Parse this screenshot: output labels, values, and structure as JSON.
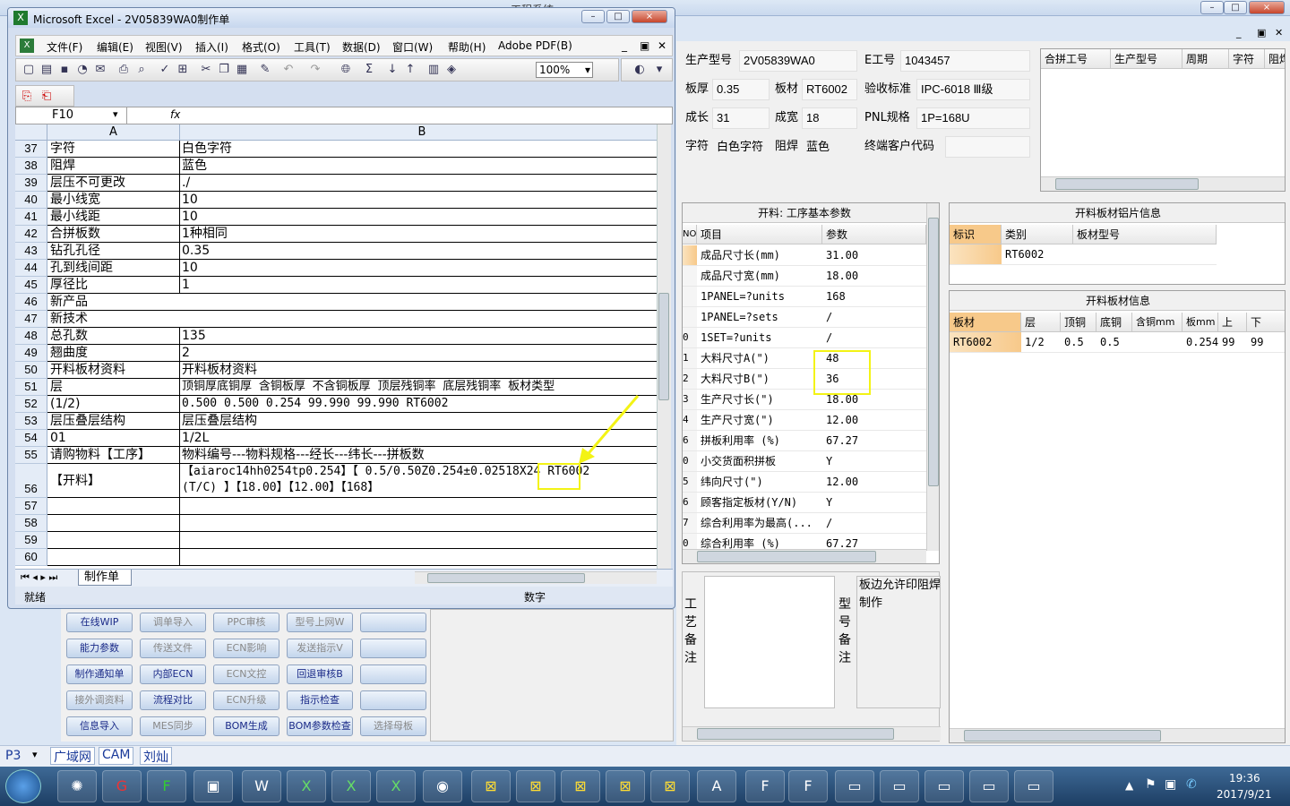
{
  "background_app": {
    "title": "工程系统",
    "window_controls": [
      "–",
      "□",
      "×"
    ],
    "header": {
      "labels": [
        "生产型号",
        "E工号",
        "板厚",
        "板材",
        "验收标准",
        "成长",
        "成宽",
        "PNL规格",
        "字符",
        "阻焊",
        "终端客户代码"
      ],
      "values": {
        "model": "2V05839WA0",
        "e_no": "1043457",
        "thickness": "0.35",
        "material": "RT6002",
        "standard": "IPC-6018 Ⅲ级",
        "length": "31",
        "width": "18",
        "pnl": "1P=168U",
        "char": "白色字符",
        "mask": "蓝色",
        "customer_code": ""
      }
    },
    "merge_grid": {
      "columns": [
        "合拼工号",
        "生产型号",
        "周期",
        "字符",
        "阻焊"
      ]
    },
    "param_panel": {
      "title": "开料: 工序基本参数",
      "columns": [
        "NO",
        "项目",
        "参数"
      ],
      "rows": [
        {
          "no": "",
          "item": "成品尺寸长(mm)",
          "value": "31.00"
        },
        {
          "no": "",
          "item": "成品尺寸宽(mm)",
          "value": "18.00"
        },
        {
          "no": "",
          "item": "1PANEL=?units",
          "value": "168"
        },
        {
          "no": "",
          "item": "1PANEL=?sets",
          "value": "/"
        },
        {
          "no": "0",
          "item": "1SET=?units",
          "value": "/"
        },
        {
          "no": "1",
          "item": "大料尺寸A(\")",
          "value": "48"
        },
        {
          "no": "2",
          "item": "大料尺寸B(\")",
          "value": "36"
        },
        {
          "no": "3",
          "item": "生产尺寸长(\")",
          "value": "18.00"
        },
        {
          "no": "4",
          "item": "生产尺寸宽(\")",
          "value": "12.00"
        },
        {
          "no": "6",
          "item": "拼板利用率 (%)",
          "value": "67.27"
        },
        {
          "no": "0",
          "item": "小交货面积拼板",
          "value": "Y"
        },
        {
          "no": "5",
          "item": "纬向尺寸(\")",
          "value": "12.00"
        },
        {
          "no": "6",
          "item": "顾客指定板材(Y/N)",
          "value": "Y"
        },
        {
          "no": "7",
          "item": "综合利用率为最高(...",
          "value": "/"
        },
        {
          "no": "0",
          "item": "综合利用率 (%)",
          "value": "67.27"
        }
      ]
    },
    "sheet_panel": {
      "title": "开料板材铝片信息",
      "columns": [
        "标识",
        "类别",
        "板材型号"
      ],
      "rows": [
        {
          "flag": "",
          "type": "RT6002",
          "model": ""
        }
      ]
    },
    "material_panel": {
      "title": "开料板材信息",
      "columns": [
        "板材",
        "层",
        "顶铜",
        "底铜",
        "含铜mm",
        "板mm",
        "上",
        "下"
      ],
      "rows": [
        {
          "mat": "RT6002",
          "layer": "1/2",
          "top": "0.5",
          "bottom": "0.5",
          "cu": "",
          "board": "0.254",
          "up": "99",
          "down": "99"
        }
      ]
    },
    "notes": {
      "process_label": "工艺备注",
      "model_label": "型号备注",
      "model_text_1": "板边允许印阻焊",
      "model_text_2": "制作"
    },
    "buttons": [
      [
        "在线WIP",
        "调单导入",
        "PPC审核",
        "型号上网W",
        ""
      ],
      [
        "能力参数",
        "传送文件",
        "ECN影响",
        "发送指示V",
        ""
      ],
      [
        "制作通知单",
        "内部ECN",
        "ECN文控",
        "回退审核B",
        ""
      ],
      [
        "接外调资料",
        "流程对比",
        "ECN升级",
        "指示检查",
        ""
      ],
      [
        "信息导入",
        "MES同步",
        "BOM生成",
        "BOM参数检查",
        "选择母板"
      ]
    ],
    "button_disabled": [
      [
        false,
        true,
        true,
        true,
        false
      ],
      [
        false,
        true,
        true,
        true,
        false
      ],
      [
        false,
        false,
        true,
        false,
        false
      ],
      [
        true,
        false,
        true,
        false,
        false
      ],
      [
        false,
        true,
        false,
        false,
        true
      ]
    ],
    "bottom_tabs": [
      "P3",
      "广域网",
      "CAM",
      "刘灿"
    ]
  },
  "excel": {
    "title": "Microsoft Excel - 2V05839WA0制作单",
    "menu": [
      "文件(F)",
      "编辑(E)",
      "视图(V)",
      "插入(I)",
      "格式(O)",
      "工具(T)",
      "数据(D)",
      "窗口(W)",
      "帮助(H)",
      "Adobe PDF(B)"
    ],
    "zoom": "100%",
    "namebox": "F10",
    "fx": "fx",
    "col_headers": [
      "A",
      "B"
    ],
    "rows": [
      {
        "n": "37",
        "a": "字符",
        "b": "白色字符"
      },
      {
        "n": "38",
        "a": "阻焊",
        "b": "蓝色"
      },
      {
        "n": "39",
        "a": "层压不可更改",
        "b": "./"
      },
      {
        "n": "40",
        "a": "最小线宽",
        "b": "10"
      },
      {
        "n": "41",
        "a": "最小线距",
        "b": "10"
      },
      {
        "n": "42",
        "a": "合拼板数",
        "b": "1种相同"
      },
      {
        "n": "43",
        "a": "钻孔孔径",
        "b": "0.35"
      },
      {
        "n": "44",
        "a": "孔到线间距",
        "b": "10"
      },
      {
        "n": "45",
        "a": "厚径比",
        "b": "1"
      },
      {
        "n": "46",
        "a": "新产品",
        "b": ""
      },
      {
        "n": "47",
        "a": "新技术",
        "b": ""
      },
      {
        "n": "48",
        "a": "总孔数",
        "b": "135"
      },
      {
        "n": "49",
        "a": "翘曲度",
        "b": "2"
      },
      {
        "n": "50",
        "a": "开料板材资料",
        "b": "开料板材资料"
      },
      {
        "n": "51",
        "a": "层",
        "b": "顶铜厚底铜厚 含铜板厚 不含铜板厚 顶层残铜率 底层残铜率 板材类型"
      },
      {
        "n": "52",
        "a": "(1/2)",
        "b": "0.500  0.500         0.254      99.990     99.990      RT6002"
      },
      {
        "n": "53",
        "a": "层压叠层结构",
        "b": "层压叠层结构"
      },
      {
        "n": "54",
        "a": "01",
        "b": "1/2L"
      },
      {
        "n": "55",
        "a": "请购物料【工序】",
        "b": "物料编号---物料规格---经长---纬长---拼板数"
      }
    ],
    "row56": {
      "n": "56",
      "a": "【开料】",
      "b1": "【aiaroc14hh0254tp0.254】【 0.5/0.50Z0.254±0.025",
      "b1_size": "18X24",
      "b1_tail": " RT6002",
      "b2": "(T/C)  】【18.00】【12.00】【168】"
    },
    "empty_rows": [
      "57",
      "58",
      "59",
      "60"
    ],
    "sheet_tab": "制作单",
    "status_left": "就绪",
    "status_mid": "数字"
  },
  "taskbar": {
    "time": "19:36",
    "date": "2017/9/21"
  }
}
